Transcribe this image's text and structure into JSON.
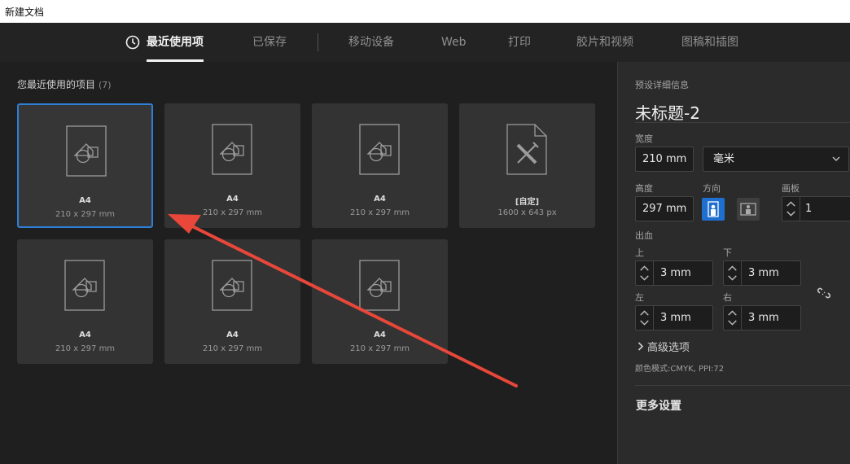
{
  "window": {
    "title": "新建文档"
  },
  "tabs": [
    {
      "label": "最近使用项",
      "active": true
    },
    {
      "label": "已保存",
      "active": false
    },
    {
      "label": "移动设备",
      "active": false
    },
    {
      "label": "Web",
      "active": false
    },
    {
      "label": "打印",
      "active": false
    },
    {
      "label": "胶片和视频",
      "active": false
    },
    {
      "label": "图稿和插图",
      "active": false
    }
  ],
  "recent": {
    "title": "您最近使用的项目",
    "count": "(7)",
    "items": [
      {
        "name": "A4",
        "size": "210 x 297 mm",
        "selected": true,
        "icon": "document-shapes-icon"
      },
      {
        "name": "A4",
        "size": "210 x 297 mm",
        "selected": false,
        "icon": "document-shapes-icon"
      },
      {
        "name": "A4",
        "size": "210 x 297 mm",
        "selected": false,
        "icon": "document-shapes-icon"
      },
      {
        "name": "[自定]",
        "size": "1600 x 643 px",
        "selected": false,
        "icon": "custom-document-icon"
      },
      {
        "name": "A4",
        "size": "210 x 297 mm",
        "selected": false,
        "icon": "document-shapes-icon"
      },
      {
        "name": "A4",
        "size": "210 x 297 mm",
        "selected": false,
        "icon": "document-shapes-icon"
      },
      {
        "name": "A4",
        "size": "210 x 297 mm",
        "selected": false,
        "icon": "document-shapes-icon"
      }
    ]
  },
  "details": {
    "header": "预设详细信息",
    "doc_name": "未标题-2",
    "width_label": "宽度",
    "width_value": "210 mm",
    "unit_value": "毫米",
    "height_label": "高度",
    "height_value": "297 mm",
    "orientation_label": "方向",
    "orientation": "portrait",
    "artboards_label": "画板",
    "artboards_value": "1",
    "bleed_label": "出血",
    "bleed": {
      "top_label": "上",
      "top_value": "3 mm",
      "bottom_label": "下",
      "bottom_value": "3 mm",
      "left_label": "左",
      "left_value": "3 mm",
      "right_label": "右",
      "right_value": "3 mm"
    },
    "advanced_label": "高级选项",
    "color_mode": "颜色模式:CMYK, PPI:72",
    "more_settings": "更多设置"
  },
  "colors": {
    "accent": "#2f7fd6",
    "annotation": "#e8473a"
  }
}
